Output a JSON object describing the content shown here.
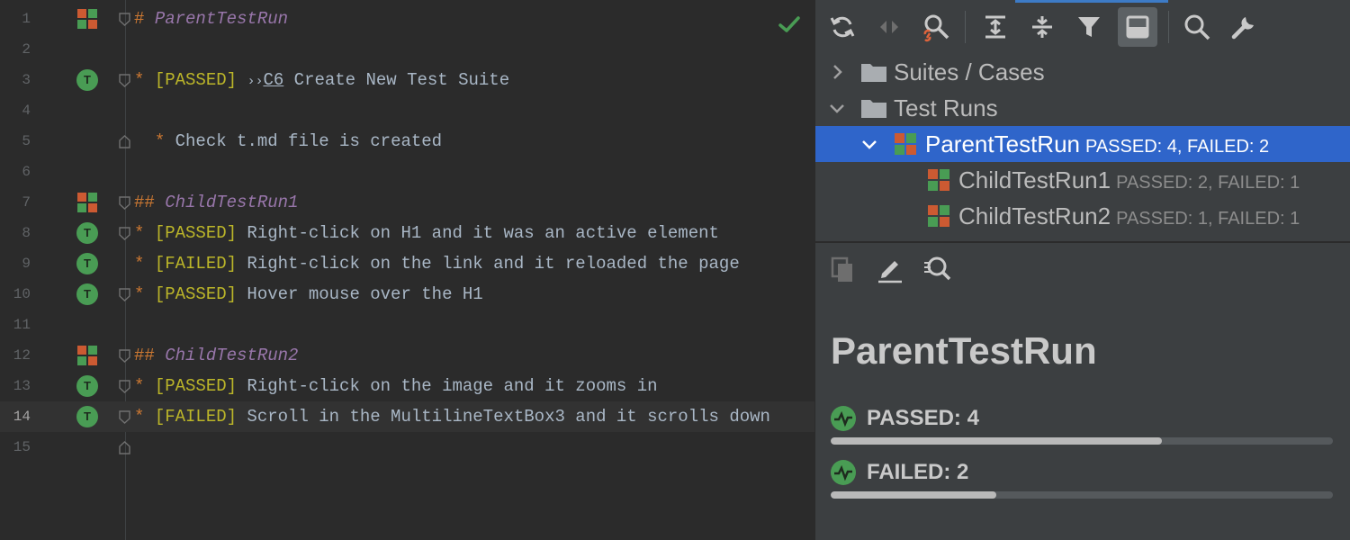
{
  "editor": {
    "lines": [
      {
        "num": "1",
        "gutter": "run",
        "fold": "open",
        "kind": "h1",
        "mark": "#",
        "text": "ParentTestRun"
      },
      {
        "num": "2",
        "gutter": "",
        "fold": "",
        "kind": "blank"
      },
      {
        "num": "3",
        "gutter": "test",
        "fold": "open",
        "kind": "item",
        "tag": "[PASSED]",
        "link": "C6",
        "text": "Create New Test Suite"
      },
      {
        "num": "4",
        "gutter": "",
        "fold": "",
        "kind": "blank"
      },
      {
        "num": "5",
        "gutter": "",
        "fold": "end",
        "kind": "sub",
        "text": "Check t.md file is created"
      },
      {
        "num": "6",
        "gutter": "",
        "fold": "",
        "kind": "blank"
      },
      {
        "num": "7",
        "gutter": "run",
        "fold": "open",
        "kind": "h2",
        "mark": "##",
        "text": "ChildTestRun1"
      },
      {
        "num": "8",
        "gutter": "test",
        "fold": "open",
        "kind": "item",
        "tag": "[PASSED]",
        "text": "Right-click on H1 and it was an active element"
      },
      {
        "num": "9",
        "gutter": "test",
        "fold": "",
        "kind": "item",
        "tag": "[FAILED]",
        "text": "Right-click on the link and it reloaded the page"
      },
      {
        "num": "10",
        "gutter": "test",
        "fold": "open",
        "kind": "item",
        "tag": "[PASSED]",
        "text": "Hover mouse over the H1"
      },
      {
        "num": "11",
        "gutter": "",
        "fold": "",
        "kind": "blank"
      },
      {
        "num": "12",
        "gutter": "run",
        "fold": "open",
        "kind": "h2",
        "mark": "##",
        "text": "ChildTestRun2"
      },
      {
        "num": "13",
        "gutter": "test",
        "fold": "open",
        "kind": "item",
        "tag": "[PASSED]",
        "text": "Right-click on the image and it zooms in"
      },
      {
        "num": "14",
        "gutter": "test",
        "fold": "open",
        "kind": "item",
        "tag": "[FAILED]",
        "text": "Scroll in the MultilineTextBox3 and it scrolls down",
        "current": true
      },
      {
        "num": "15",
        "gutter": "",
        "fold": "end",
        "kind": "blank"
      }
    ],
    "bullet": "*",
    "quote_mark": "››",
    "gutter_test_letter": "T"
  },
  "toolbar": {
    "buttons": [
      "refresh-icon",
      "prev-next-icon",
      "find-linked-icon",
      "expand-all-icon",
      "collapse-all-icon",
      "filter-icon",
      "preview-icon",
      "search-icon",
      "settings-icon"
    ],
    "active": "preview-icon"
  },
  "tree": {
    "suites": {
      "label": "Suites / Cases",
      "expanded": false
    },
    "runs": {
      "label": "Test Runs",
      "expanded": true
    },
    "parent": {
      "label": "ParentTestRun",
      "stats": "PASSED: 4, FAILED: 2",
      "selected": true
    },
    "children": [
      {
        "label": "ChildTestRun1",
        "stats": "PASSED: 2, FAILED: 1"
      },
      {
        "label": "ChildTestRun2",
        "stats": "PASSED: 1, FAILED: 1"
      }
    ]
  },
  "details": {
    "toolbar": [
      "copy-icon",
      "edit-icon",
      "find-usages-icon"
    ],
    "title": "ParentTestRun",
    "stats": [
      {
        "label": "PASSED: 4",
        "fraction": 0.66
      },
      {
        "label": "FAILED: 2",
        "fraction": 0.33
      }
    ]
  },
  "colors": {
    "pass_green": "#499c54",
    "run_icon": [
      "#cc5a32",
      "#499c54",
      "#499c54",
      "#cc5a32"
    ],
    "selection": "#2f65ca"
  }
}
